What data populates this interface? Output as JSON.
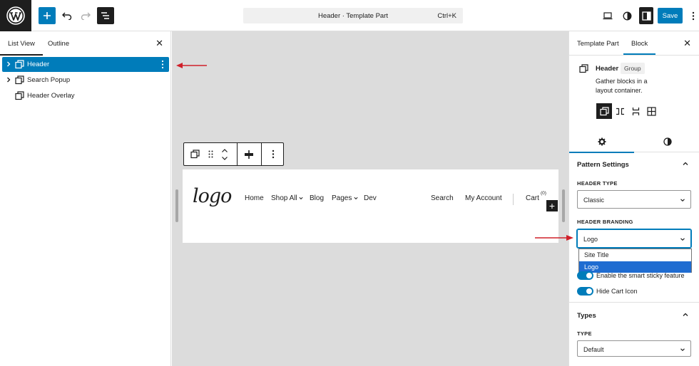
{
  "topbar": {
    "command_title": "Header · Template Part",
    "command_shortcut": "Ctrl+K",
    "save_label": "Save"
  },
  "left_panel": {
    "tabs": [
      {
        "label": "List View",
        "active": true
      },
      {
        "label": "Outline",
        "active": false
      }
    ],
    "items": [
      {
        "label": "Header",
        "selected": true,
        "expandable": true
      },
      {
        "label": "Search Popup",
        "selected": false,
        "expandable": true
      },
      {
        "label": "Header Overlay",
        "selected": false,
        "expandable": false
      }
    ]
  },
  "preview": {
    "logo": "logo",
    "nav": [
      "Home",
      "Shop All",
      "Blog",
      "Pages",
      "Dev"
    ],
    "right_nav": [
      "Search",
      "My Account",
      "Cart"
    ],
    "cart_count": "(0)"
  },
  "right_panel": {
    "tabs": [
      {
        "label": "Template Part",
        "active": false
      },
      {
        "label": "Block",
        "active": true
      }
    ],
    "block": {
      "title": "Header",
      "badge": "Group",
      "description": "Gather blocks in a layout container."
    },
    "pattern_settings": {
      "title": "Pattern Settings",
      "header_type_label": "HEADER TYPE",
      "header_type_value": "Classic",
      "header_branding_label": "HEADER BRANDING",
      "header_branding_value": "Logo",
      "branding_options": [
        "Site Title",
        "Logo"
      ],
      "sticky_label": "Enable the smart sticky feature",
      "hide_cart_label": "Hide Cart Icon"
    },
    "types": {
      "title": "Types",
      "type_label": "TYPE",
      "type_value": "Default"
    }
  },
  "colors": {
    "accent": "#007cba",
    "dark": "#1e1e1e",
    "canvas": "#dcdcdc",
    "annotation": "#d0202a"
  }
}
